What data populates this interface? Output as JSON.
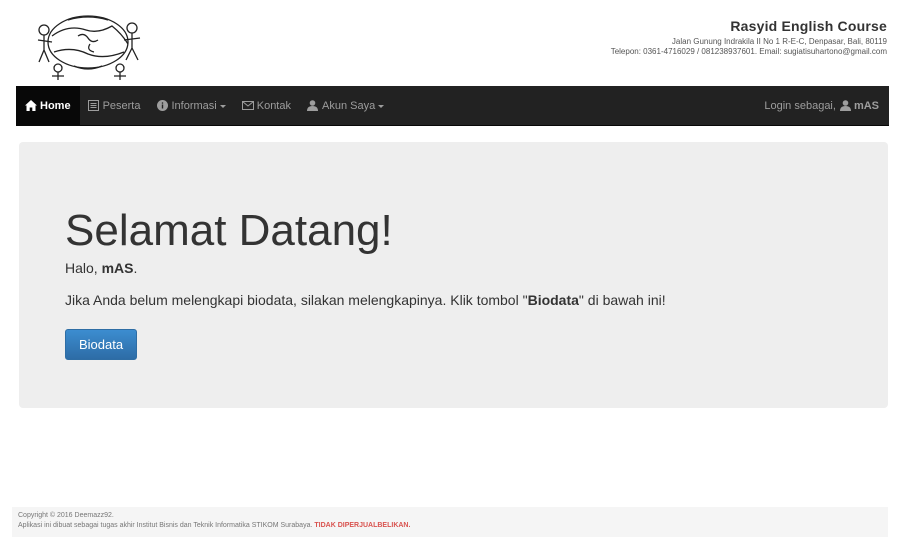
{
  "header": {
    "org_name": "Rasyid English Course",
    "address": "Jalan Gunung Indrakila II No 1 R-E-C, Denpasar, Bali, 80119",
    "contact": "Telepon: 0361-4716029 / 081238937601. Email: sugiatisuhartono@gmail.com"
  },
  "navbar": {
    "items": [
      {
        "label": "Home",
        "icon": "home-icon",
        "active": true
      },
      {
        "label": "Peserta",
        "icon": "list-icon"
      },
      {
        "label": "Informasi",
        "icon": "info-icon",
        "dropdown": true
      },
      {
        "label": "Kontak",
        "icon": "envelope-icon"
      },
      {
        "label": "Akun Saya",
        "icon": "user-icon",
        "dropdown": true
      }
    ],
    "login_prefix": "Login sebagai,",
    "login_user": "mAS"
  },
  "main": {
    "title": "Selamat Datang!",
    "greeting_prefix": "Halo,",
    "greeting_name": "mAS",
    "greeting_suffix": ".",
    "info_prefix": "Jika Anda belum melengkapi biodata, silakan melengkapinya. Klik tombol \"",
    "info_bold": "Biodata",
    "info_suffix": "\" di bawah ini!",
    "button_label": "Biodata"
  },
  "footer": {
    "copyright": "Copyright © 2016 Deemazz92.",
    "note": "Aplikasi ini dibuat sebagai tugas akhir Institut Bisnis dan Teknik Informatika STIKOM Surabaya.",
    "warning": "TIDAK DIPERJUALBELIKAN."
  },
  "colors": {
    "navbar_bg": "#222222",
    "jumbotron_bg": "#eeeeee",
    "button_bg": "#337ab7",
    "warning": "#d9534f"
  }
}
